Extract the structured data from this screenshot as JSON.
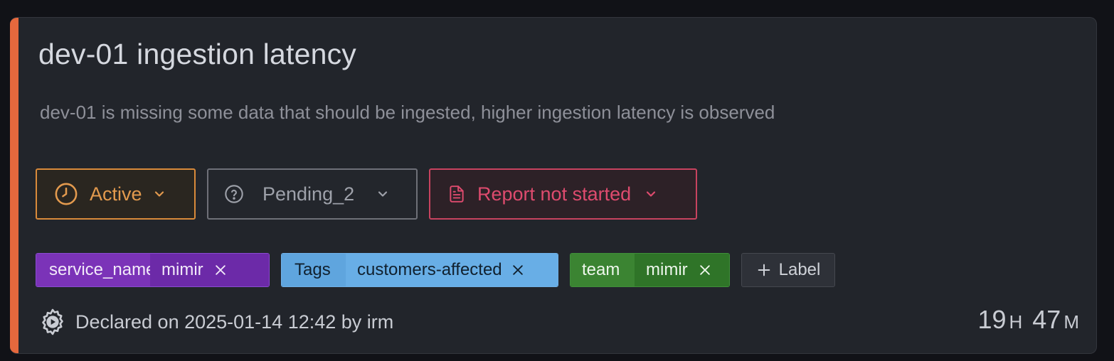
{
  "incident": {
    "title": "dev-01 ingestion latency",
    "description": "dev-01 is missing some data that should be ingested, higher ingestion latency is observed",
    "accent_color": "#e5683d"
  },
  "status": {
    "state": {
      "label": "Active",
      "icon": "clock-icon",
      "color": "#e39a4e"
    },
    "severity": {
      "label": "Pending_2",
      "icon": "question-circle-icon",
      "color": "#9ea1aa"
    },
    "report": {
      "label": "Report not started",
      "icon": "document-icon",
      "color": "#de4b6e"
    }
  },
  "labels": [
    {
      "key": "service_name",
      "value": "mimir",
      "color": "#7b33b8"
    },
    {
      "key": "Tags",
      "value": "customers-affected",
      "color": "#5fa5de"
    },
    {
      "key": "team",
      "value": "mimir",
      "color": "#3b8432"
    }
  ],
  "add_label": {
    "text": "Label",
    "icon": "plus-icon"
  },
  "footer": {
    "declared_text": "Declared on 2025-01-14 12:42 by irm",
    "icon": "gear-play-icon"
  },
  "timer": {
    "hours": "19",
    "hours_unit": "H",
    "minutes": "47",
    "minutes_unit": "M"
  }
}
